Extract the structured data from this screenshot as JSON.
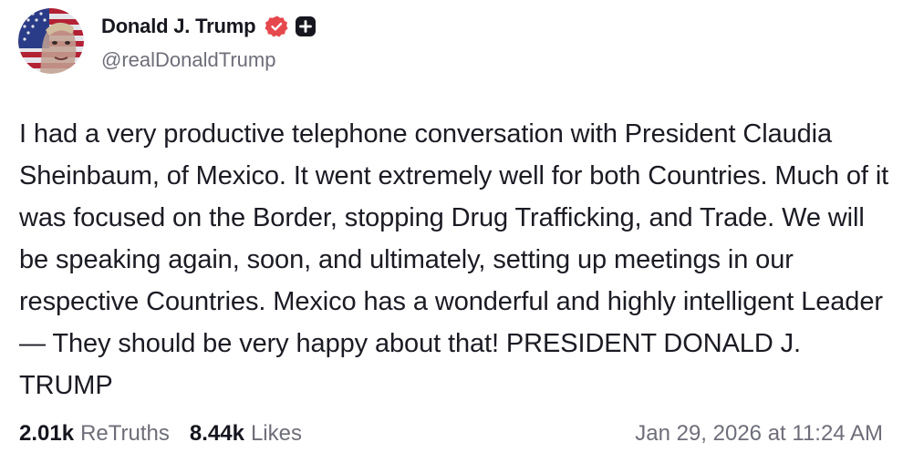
{
  "author": {
    "display_name": "Donald J. Trump",
    "handle": "@realDonaldTrump",
    "avatar_icon": "avatar-flag-portrait",
    "verified_icon": "verified-badge-icon",
    "verified_color": "#e5484d",
    "plus_icon": "plus-badge-icon"
  },
  "post": {
    "text": "I had a very productive telephone conversation with President Claudia Sheinbaum, of Mexico. It went extremely well for both Countries. Much of it was focused on the Border, stopping Drug Trafficking, and Trade. We will be speaking again, soon, and ultimately, setting up meetings in our respective Countries. Mexico has a wonderful and highly intelligent Leader — They should be very happy about that! PRESIDENT DONALD J. TRUMP"
  },
  "stats": {
    "retruths_count": "2.01k",
    "retruths_label": "ReTruths",
    "likes_count": "8.44k",
    "likes_label": "Likes"
  },
  "timestamp": "Jan 29, 2026 at 11:24 AM"
}
